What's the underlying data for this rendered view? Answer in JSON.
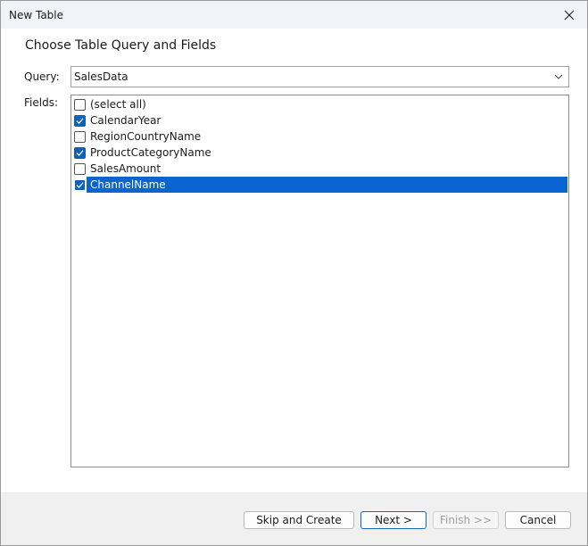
{
  "window": {
    "title": "New Table"
  },
  "heading": "Choose Table Query and Fields",
  "query": {
    "label": "Query:",
    "value": "SalesData"
  },
  "fields": {
    "label": "Fields:",
    "items": [
      {
        "label": "(select all)",
        "checked": false,
        "selected": false
      },
      {
        "label": "CalendarYear",
        "checked": true,
        "selected": false
      },
      {
        "label": "RegionCountryName",
        "checked": false,
        "selected": false
      },
      {
        "label": "ProductCategoryName",
        "checked": true,
        "selected": false
      },
      {
        "label": "SalesAmount",
        "checked": false,
        "selected": false
      },
      {
        "label": "ChannelName",
        "checked": true,
        "selected": true
      }
    ]
  },
  "buttons": {
    "skip_create": "Skip and Create",
    "next": "Next >",
    "finish": "Finish >>",
    "cancel": "Cancel"
  },
  "colors": {
    "accent": "#0f5fbc",
    "selection": "#0a64d2",
    "titlebar": "#f0f4f9",
    "footer": "#f0f0f0"
  },
  "icons": {
    "close": "close-icon",
    "dropdown": "chevron-down-icon",
    "check": "check-icon"
  }
}
